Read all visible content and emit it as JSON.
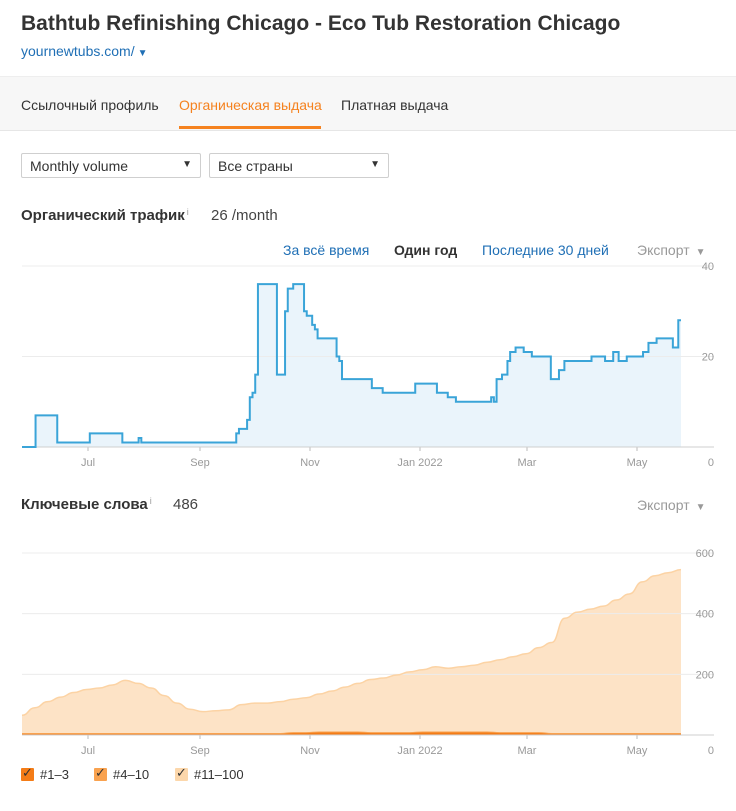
{
  "header": {
    "title": "Bathtub Refinishing Chicago - Eco Tub Restoration Chicago",
    "url": "yournewtubs.com/"
  },
  "tabs": [
    {
      "label": "Ссылочный профиль"
    },
    {
      "label": "Органическая выдача",
      "active": true
    },
    {
      "label": "Платная выдача"
    }
  ],
  "filters": {
    "volume": "Monthly volume",
    "country": "Все страны"
  },
  "traffic": {
    "title": "Органический трафик",
    "info": "i",
    "value": "26 /month",
    "ranges": [
      "За всё время",
      "Один год",
      "Последние 30 дней"
    ],
    "active_range": "Один год",
    "export": "Экспорт"
  },
  "keywords": {
    "title": "Ключевые слова",
    "info": "i",
    "value": "486",
    "export": "Экспорт"
  },
  "legend": [
    {
      "label": "#1–3",
      "color": "#f47c17"
    },
    {
      "label": "#4–10",
      "color": "#f9a24f"
    },
    {
      "label": "#11–100",
      "color": "#fcd7ab"
    }
  ],
  "colors": {
    "accent": "#f5821f",
    "link": "#1f6fb5",
    "traffic_line": "#3aa4d8",
    "traffic_fill": "#eaf4fb"
  },
  "chart_data": [
    {
      "type": "area",
      "title": "Органический трафик",
      "x_unit": "week",
      "x_ticks": [
        "Jul",
        "Sep",
        "Nov",
        "Jan 2022",
        "Mar",
        "May"
      ],
      "y_ticks": [
        0,
        20,
        40
      ],
      "ylim": [
        0,
        40
      ],
      "series": [
        {
          "values": [
            0,
            0,
            0,
            0,
            0,
            7,
            7,
            7,
            7,
            7,
            7,
            7,
            7,
            1,
            1,
            1,
            1,
            1,
            1,
            1,
            1,
            1,
            1,
            1,
            1,
            3,
            3,
            3,
            3,
            3,
            3,
            3,
            3,
            3,
            3,
            3,
            3,
            1,
            1,
            1,
            1,
            1,
            1,
            2,
            1,
            1,
            1,
            1,
            1,
            1,
            1,
            1,
            1,
            1,
            1,
            1,
            1,
            1,
            1,
            1,
            1,
            1,
            1,
            1,
            1,
            1,
            1,
            1,
            1,
            1,
            1,
            1,
            1,
            1,
            1,
            1,
            1,
            1,
            1,
            3,
            4,
            4,
            4,
            6,
            11,
            12,
            16,
            36,
            36,
            36,
            36,
            36,
            36,
            36,
            16,
            16,
            16,
            30,
            35,
            35,
            36,
            36,
            36,
            36,
            30,
            29,
            29,
            27,
            26,
            24,
            24,
            24,
            24,
            24,
            24,
            24,
            20,
            19,
            15,
            15,
            15,
            15,
            15,
            15,
            15,
            15,
            15,
            15,
            15,
            13,
            13,
            13,
            13,
            12,
            12,
            12,
            12,
            12,
            12,
            12,
            12,
            12,
            12,
            12,
            12,
            14,
            14,
            14,
            14,
            14,
            14,
            14,
            14,
            12,
            12,
            12,
            12,
            11,
            11,
            11,
            10,
            10,
            10,
            10,
            10,
            10,
            10,
            10,
            10,
            10,
            10,
            10,
            10,
            11,
            10,
            15,
            15,
            16,
            16,
            19,
            21,
            21,
            22,
            22,
            22,
            21,
            21,
            21,
            20,
            20,
            20,
            20,
            20,
            20,
            20,
            15,
            15,
            15,
            17,
            17,
            19,
            19,
            19,
            19,
            19,
            19,
            19,
            19,
            19,
            19,
            20,
            20,
            20,
            20,
            20,
            19,
            19,
            19,
            21,
            21,
            19,
            19,
            19,
            20,
            20,
            20,
            20,
            20,
            20,
            21,
            21,
            23,
            23,
            23,
            24,
            24,
            24,
            24,
            24,
            24,
            22,
            22,
            28,
            28
          ]
        }
      ]
    },
    {
      "type": "area",
      "title": "Ключевые слова",
      "x_unit": "week",
      "x_ticks": [
        "Jul",
        "Sep",
        "Nov",
        "Jan 2022",
        "Mar",
        "May"
      ],
      "y_ticks": [
        0,
        200,
        400,
        600
      ],
      "ylim": [
        0,
        600
      ],
      "series": [
        {
          "name": "#11–100",
          "values": [
            60,
            85,
            105,
            120,
            135,
            145,
            150,
            160,
            175,
            165,
            150,
            125,
            100,
            80,
            72,
            75,
            78,
            95,
            100,
            100,
            105,
            110,
            115,
            125,
            135,
            148,
            160,
            175,
            180,
            190,
            200,
            205,
            215,
            210,
            215,
            220,
            230,
            240,
            250,
            260,
            280,
            300,
            380,
            400,
            410,
            420,
            440,
            460,
            500,
            520,
            530,
            540
          ]
        },
        {
          "name": "#4–10",
          "values": [
            0,
            0,
            0,
            0,
            0,
            0,
            0,
            0,
            0,
            0,
            0,
            0,
            0,
            0,
            0,
            0,
            0,
            0,
            0,
            0,
            0,
            0,
            0,
            0,
            0,
            0,
            0,
            0,
            0,
            0,
            0,
            0,
            0,
            0,
            0,
            0,
            0,
            0,
            0,
            0,
            0,
            0,
            0,
            0,
            0,
            0,
            0,
            0,
            0,
            0,
            0,
            0
          ]
        },
        {
          "name": "#1–3",
          "values": [
            5,
            5,
            5,
            5,
            5,
            5,
            5,
            5,
            5,
            5,
            5,
            5,
            5,
            5,
            5,
            5,
            5,
            5,
            5,
            5,
            5,
            8,
            8,
            10,
            10,
            10,
            10,
            8,
            8,
            8,
            8,
            10,
            10,
            10,
            10,
            10,
            10,
            8,
            8,
            8,
            8,
            5,
            5,
            5,
            5,
            5,
            5,
            5,
            5,
            5,
            5,
            5
          ]
        }
      ]
    }
  ]
}
